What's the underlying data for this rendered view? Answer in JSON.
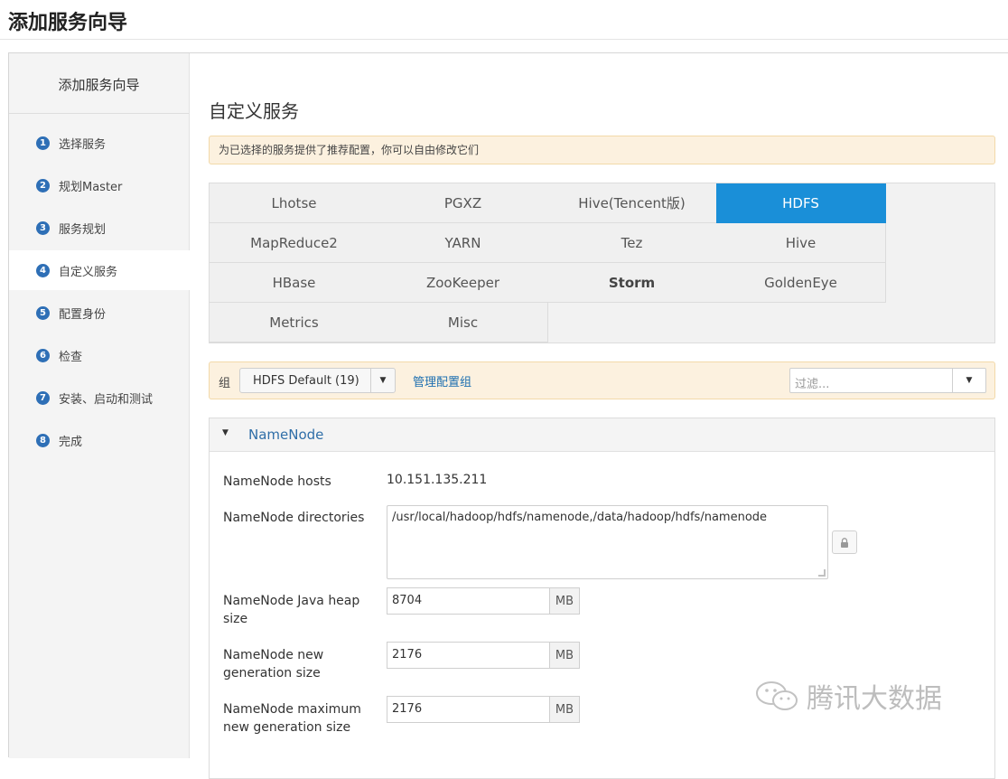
{
  "header": {
    "title": "添加服务向导"
  },
  "sidebar": {
    "title": "添加服务向导",
    "steps": [
      {
        "num": "1",
        "label": "选择服务"
      },
      {
        "num": "2",
        "label": "规划Master"
      },
      {
        "num": "3",
        "label": "服务规划"
      },
      {
        "num": "4",
        "label": "自定义服务"
      },
      {
        "num": "5",
        "label": "配置身份"
      },
      {
        "num": "6",
        "label": "检查"
      },
      {
        "num": "7",
        "label": "安装、启动和测试"
      },
      {
        "num": "8",
        "label": "完成"
      }
    ],
    "active_step": "4"
  },
  "main": {
    "title": "自定义服务",
    "alert": "为已选择的服务提供了推荐配置，你可以自由修改它们",
    "services": [
      [
        "Lhotse",
        "PGXZ",
        "Hive(Tencent版)",
        "HDFS"
      ],
      [
        "MapReduce2",
        "YARN",
        "Tez",
        "Hive"
      ],
      [
        "HBase",
        "ZooKeeper",
        "Storm",
        "GoldenEye"
      ],
      [
        "Metrics",
        "Misc"
      ]
    ],
    "selected_service": "HDFS",
    "group": {
      "label": "组",
      "selected": "HDFS Default (19)",
      "manage_link": "管理配置组",
      "filter_placeholder": "过滤..."
    },
    "panel": {
      "title": "NameNode",
      "fields": {
        "hosts_label": "NameNode hosts",
        "hosts_value": "10.151.135.211",
        "dirs_label": "NameNode directories",
        "dirs_value": "/usr/local/hadoop/hdfs/namenode,/data/hadoop/hdfs/namenode",
        "heap_label": "NameNode Java heap size",
        "heap_value": "8704",
        "newgen_label": "NameNode new generation size",
        "newgen_value": "2176",
        "maxnewgen_label": "NameNode maximum new generation size",
        "maxnewgen_value": "2176",
        "unit": "MB"
      }
    }
  },
  "watermark": "腾讯大数据",
  "colors": {
    "accent": "#1a8fd8",
    "step_badge": "#2e6fb6",
    "alert_bg": "#fcf1df",
    "link": "#1d6fb0"
  }
}
